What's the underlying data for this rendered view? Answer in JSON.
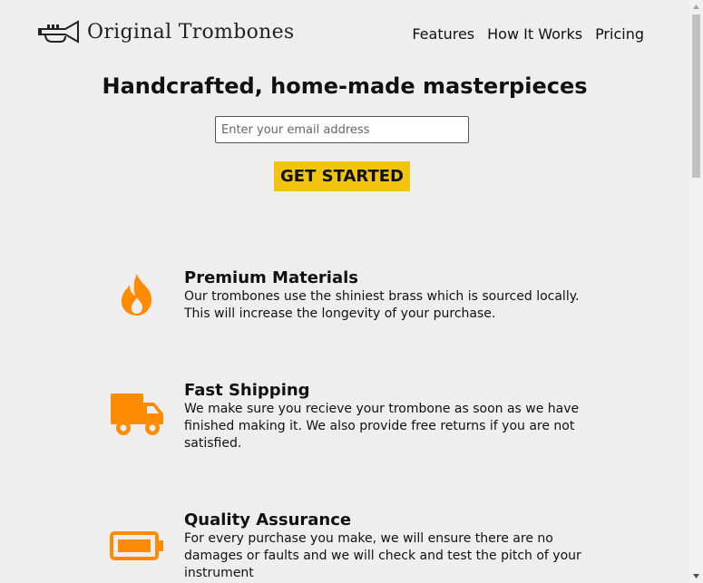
{
  "header": {
    "brand": "Original Trombones",
    "logo_icon": "trumpet-icon",
    "nav": [
      {
        "label": "Features"
      },
      {
        "label": "How It Works"
      },
      {
        "label": "Pricing"
      }
    ]
  },
  "hero": {
    "title": "Handcrafted, home-made masterpieces",
    "email_placeholder": "Enter your email address",
    "cta_label": "GET STARTED"
  },
  "features": [
    {
      "icon": "fire-icon",
      "title": "Premium Materials",
      "description": "Our trombones use the shiniest brass which is sourced locally. This will increase the longevity of your purchase."
    },
    {
      "icon": "truck-icon",
      "title": "Fast Shipping",
      "description": "We make sure you recieve your trombone as soon as we have finished making it. We also provide free returns if you are not satisfied."
    },
    {
      "icon": "battery-icon",
      "title": "Quality Assurance",
      "description": "For every purchase you make, we will ensure there are no damages or faults and we will check and test the pitch of your instrument"
    }
  ],
  "colors": {
    "background": "#eeeeee",
    "accent": "#f1c40f",
    "icon": "#ff8c00"
  }
}
